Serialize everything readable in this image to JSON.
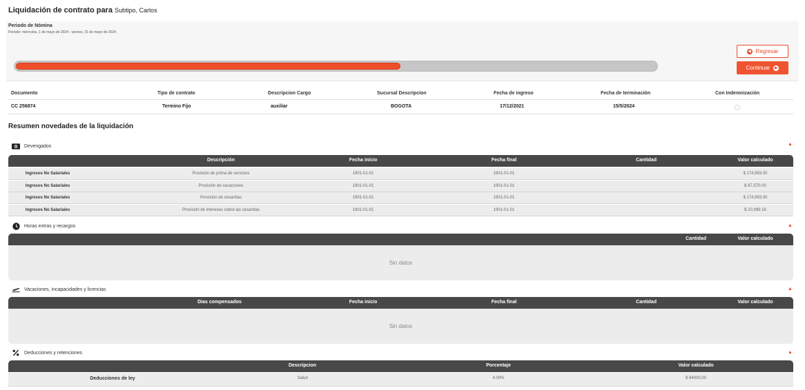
{
  "header": {
    "title": "Liquidación de contrato para",
    "employee": "Subtipo, Carlos"
  },
  "period": {
    "label": "Periodo de Nómina",
    "range": "Periodo: miércoles, 1 de mayo de 2024 - viernes, 31 de mayo de 2024",
    "progress_percent": 60
  },
  "buttons": {
    "back": "Regresar",
    "continue": "Continuar"
  },
  "contract": {
    "headers": [
      "Documento",
      "Tipo de contrato",
      "Descripcion Cargo",
      "Sucursal Descripcion",
      "Fecha de ingreso",
      "Fecha de terminación",
      "Con Indemnización"
    ],
    "values": [
      "CC 256874",
      "Termino Fijo",
      "auxiliar",
      "BOGOTA",
      "17/12/2021",
      "15/5/2024"
    ],
    "indemnizacion": false
  },
  "summary_title": "Resumen novedades de la liquidación",
  "devengados": {
    "title": "Devengados",
    "icon": "money-icon",
    "columns": [
      "Descripción",
      "Fecha inicio",
      "Fecha final",
      "Cantidad",
      "Valor calculado"
    ],
    "rows": [
      {
        "category": "Ingresos No Salariales",
        "description": "Provisión de prima de servicios",
        "start": "1901-01-01",
        "end": "1901-01-01",
        "value": "$ 174,993.00"
      },
      {
        "category": "Ingresos No Salariales",
        "description": "Provisión de vacaciones",
        "start": "1901-01-01",
        "end": "1901-01-01",
        "value": "$ 87,570.00"
      },
      {
        "category": "Ingresos No Salariales",
        "description": "Provisión de cesantias",
        "start": "1901-01-01",
        "end": "1901-01-01",
        "value": "$ 174,993.00"
      },
      {
        "category": "Ingresos No Salariales",
        "description": "Provisión de intereses sobre las cesantias",
        "start": "1901-01-01",
        "end": "1901-01-01",
        "value": "$ 20,999.16"
      }
    ]
  },
  "horas": {
    "title": "Horas extras y recargos",
    "icon": "clock-icon",
    "columns": [
      "Cantidad",
      "Valor calculado"
    ],
    "empty": "Sin datos"
  },
  "vacaciones": {
    "title": "Vacaciones, incapacidades y licencias",
    "icon": "airplane-icon",
    "columns": [
      "Dias compensados",
      "Fecha inicio",
      "Fecha final",
      "Cantidad",
      "Valor calculado"
    ],
    "empty": "Sin datos"
  },
  "deducciones": {
    "title": "Deducciones y retenciones",
    "icon": "percent-icon",
    "columns": [
      "Descripcion",
      "Porcentaje",
      "Valor calculado"
    ],
    "rows": [
      {
        "category": "Deducciones de ley",
        "description": "Salud",
        "percent": "4.00%",
        "value": "$ 84000,00"
      }
    ]
  },
  "colors": {
    "accent": "#f0532f",
    "table_header": "#484848",
    "row_bg": "#ececec"
  }
}
